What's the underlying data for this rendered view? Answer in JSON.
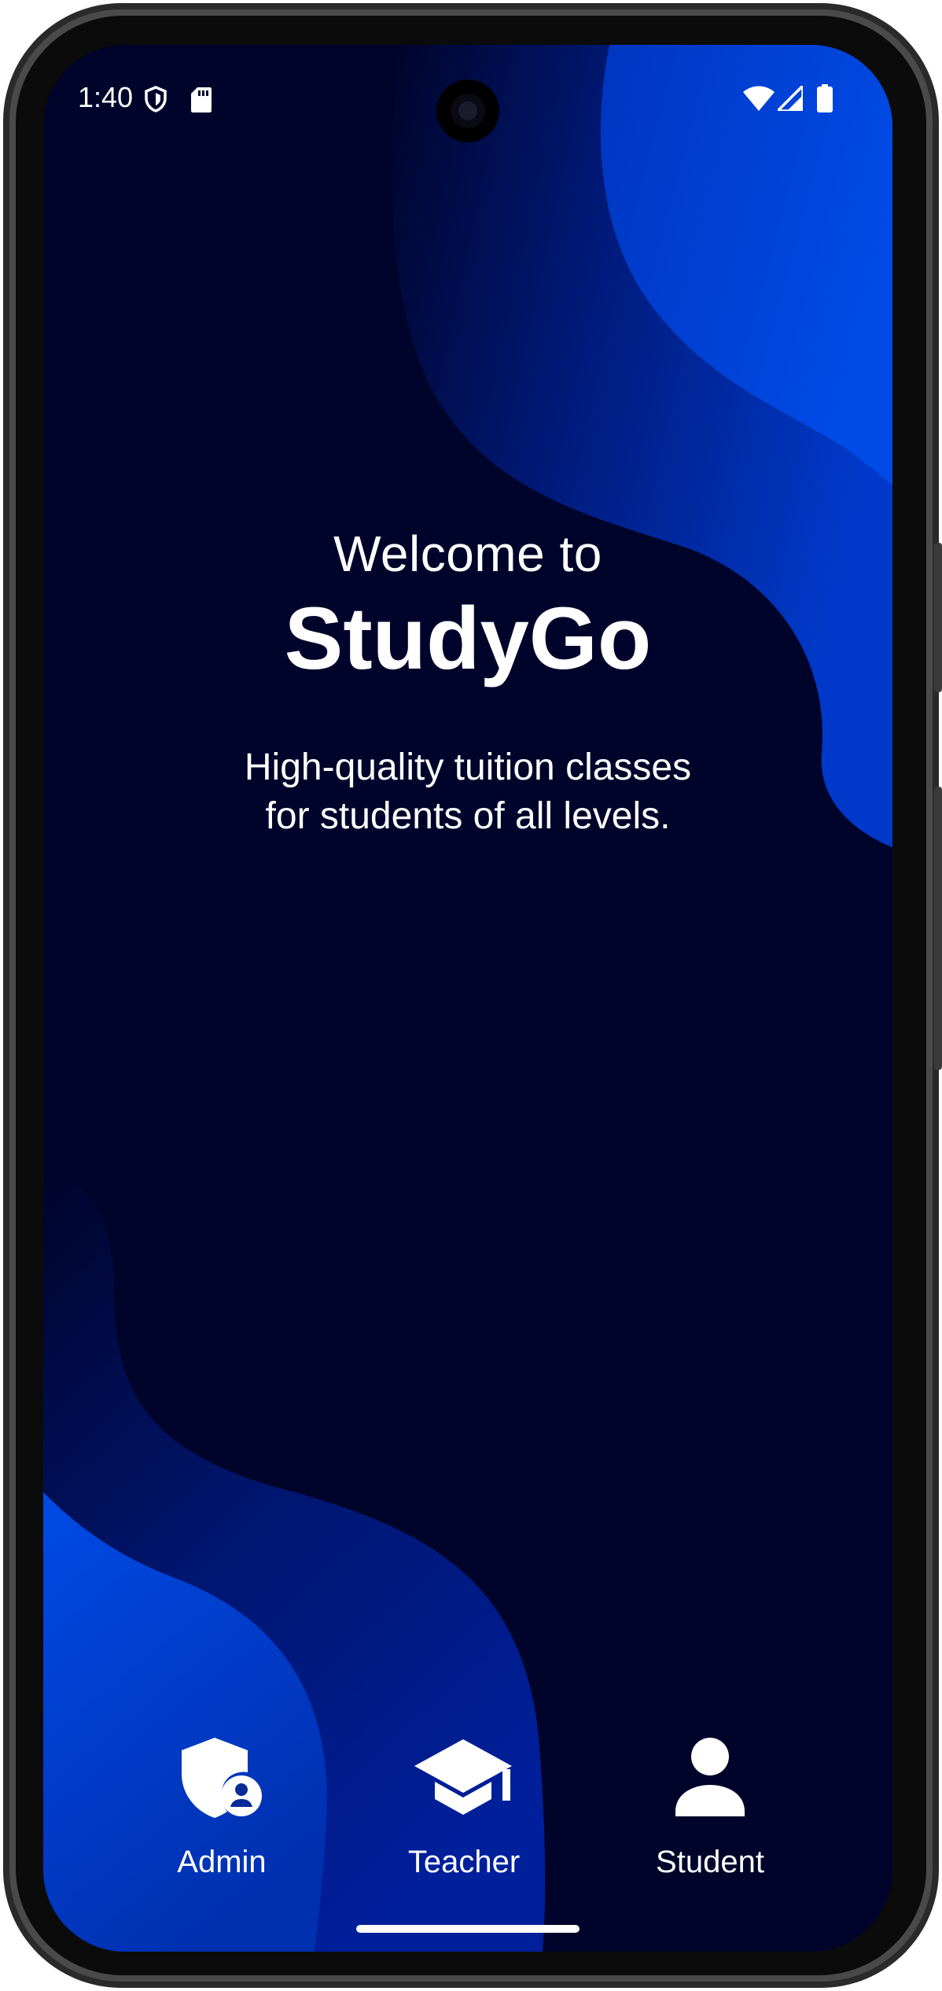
{
  "status_bar": {
    "time": "1:40",
    "left_icons": [
      "shield-icon",
      "sd-card-icon"
    ],
    "right_icons": [
      "wifi-icon",
      "cell-signal-icon",
      "battery-icon"
    ]
  },
  "welcome": {
    "greeting": "Welcome to",
    "app_name": "StudyGo",
    "tagline_line1": "High-quality tuition classes",
    "tagline_line2": "for students of all levels."
  },
  "roles": [
    {
      "label": "Admin",
      "icon": "admin-shield-icon"
    },
    {
      "label": "Teacher",
      "icon": "graduation-cap-icon"
    },
    {
      "label": "Student",
      "icon": "person-icon"
    }
  ],
  "colors": {
    "background": "#00042a",
    "wave_dark": "#001a8c",
    "wave_bright": "#0044dd",
    "text": "#ffffff",
    "frame": "#1a1a1a"
  }
}
